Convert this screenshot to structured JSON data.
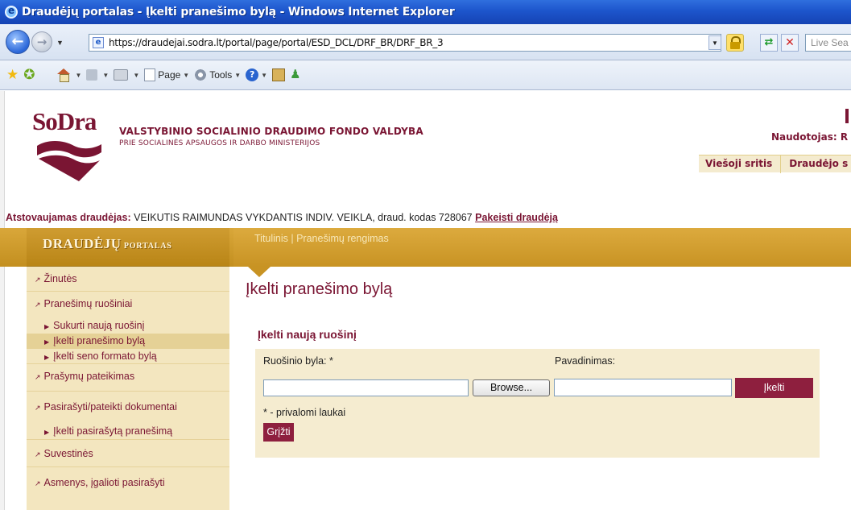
{
  "window": {
    "title": "Draudėjų portalas - Įkelti pranešimo bylą - Windows Internet Explorer"
  },
  "address": {
    "url": "https://draudejai.sodra.lt/portal/page/portal/ESD_DCL/DRF_BR/DRF_BR_3",
    "search_placeholder": "Live Sea"
  },
  "toolbar": {
    "page_label": "Page",
    "tools_label": "Tools"
  },
  "header": {
    "logo_text": "SoDra",
    "agency_name": "VALSTYBINIO SOCIALINIO DRAUDIMO FONDO VALDYBA",
    "agency_sub": "PRIE SOCIALINĖS APSAUGOS IR DARBO MINISTERIJOS",
    "user_label": "Naudotojas: R",
    "tabs": [
      {
        "label": "Viešoji sritis"
      },
      {
        "label": "Draudėjo s"
      }
    ]
  },
  "represented": {
    "label": "Atstovaujamas draudėjas:",
    "value": "VEIKUTIS RAIMUNDAS VYKDANTIS INDIV. VEIKLA, draud. kodas 728067",
    "change_link": "Pakeisti draudėją"
  },
  "breadcrumb": "Titulinis | Pranešimų rengimas",
  "sidebar": {
    "title_big": "DRAUDĖJŲ",
    "title_small": "PORTALAS",
    "items": {
      "zinutes": "Žinutės",
      "pranesimu_ruosiniai": "Pranešimų ruošiniai",
      "sub_sukurti": "Sukurti naują ruošinį",
      "sub_ikelti": "Įkelti pranešimo bylą",
      "sub_seno": "Įkelti seno formato bylą",
      "prasymu": "Prašymų pateikimas",
      "pasirasyti": "Pasirašyti/pateikti dokumentai",
      "sub_pasirasyta": "Įkelti pasirašytą pranešimą",
      "suvestines": "Suvestinės",
      "asmenys": "Asmenys, įgalioti pasirašyti"
    }
  },
  "main": {
    "title": "Įkelti pranešimo bylą",
    "section_title": "Įkelti naują ruošinį",
    "file_label": "Ruošinio byla: *",
    "name_label": "Pavadinimas:",
    "browse_label": "Browse...",
    "upload_label": "Įkelti",
    "required_note": "* - privalomi laukai",
    "back_label": "Grįžti",
    "file_value": "",
    "name_value": ""
  },
  "colors": {
    "brand": "#7a1533",
    "button": "#8e1f3e",
    "band": "#c89323",
    "sidebar_bg": "#f3e6bf"
  }
}
